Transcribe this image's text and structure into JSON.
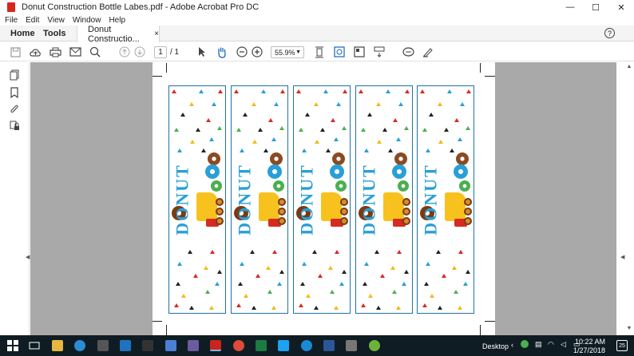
{
  "window": {
    "title": "Donut Construction Bottle Labes.pdf - Adobe Acrobat Pro DC",
    "minimize": "—",
    "maximize": "☐",
    "close": "✕"
  },
  "menu": [
    "File",
    "Edit",
    "View",
    "Window",
    "Help"
  ],
  "tabs": {
    "home": "Home",
    "tools": "Tools",
    "doc": "Donut Constructio...",
    "doc_close": "×"
  },
  "help": "?",
  "toolbar": {
    "page_current": "1",
    "page_total": "/ 1",
    "zoom": "55.9%"
  },
  "label": {
    "word": "DONUT"
  },
  "taskbar": {
    "desktop": "Desktop",
    "time": "10:22 AM",
    "date": "1/27/2018",
    "notif": "25"
  },
  "colors": {
    "label_border": "#1f72a8",
    "word": "#2a9fd6",
    "workarea": "#a9a9a9",
    "taskbar": "#0f1c24"
  }
}
